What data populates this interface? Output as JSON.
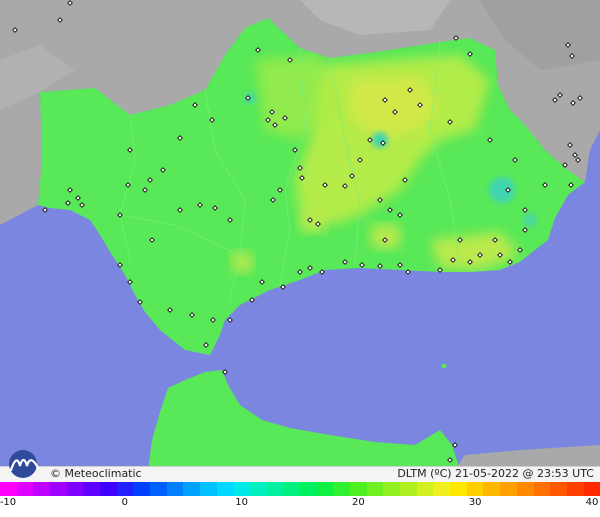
{
  "brand": "© Meteoclimatic",
  "caption": "DLTM (ºC)  21-05-2022 @ 23:53 UTC",
  "legend": {
    "unit": "ºC",
    "min": -10,
    "max": 40,
    "ticks": [
      "-10",
      "0",
      "10",
      "20",
      "30",
      "40"
    ],
    "colors": [
      "#ff00ff",
      "#e000ff",
      "#c000ff",
      "#a000ff",
      "#8000ff",
      "#6000ff",
      "#4000ff",
      "#2020ff",
      "#0040ff",
      "#0060ff",
      "#0080ff",
      "#00a0ff",
      "#00c0ff",
      "#00d8ff",
      "#00e8e8",
      "#00f0c0",
      "#00f0a0",
      "#00f080",
      "#00f060",
      "#10f040",
      "#30f030",
      "#50f020",
      "#70f020",
      "#90f020",
      "#b0f020",
      "#d0f020",
      "#f0f020",
      "#ffe800",
      "#ffd000",
      "#ffb800",
      "#ffa000",
      "#ff8800",
      "#ff7000",
      "#ff5800",
      "#ff4000",
      "#ff2800"
    ]
  },
  "colors": {
    "sea": "#7a86e0",
    "land_outside": "#aaaaaa",
    "region_base": "#58e858",
    "warm_patch": "#c6ea4c",
    "cool_patch": "#3fd4b0",
    "station": "#111111"
  },
  "stations": [
    [
      258,
      50
    ],
    [
      290,
      60
    ],
    [
      248,
      98
    ],
    [
      272,
      112
    ],
    [
      268,
      120
    ],
    [
      275,
      125
    ],
    [
      285,
      118
    ],
    [
      212,
      120
    ],
    [
      195,
      105
    ],
    [
      180,
      138
    ],
    [
      130,
      150
    ],
    [
      163,
      170
    ],
    [
      150,
      180
    ],
    [
      145,
      190
    ],
    [
      128,
      185
    ],
    [
      70,
      190
    ],
    [
      78,
      198
    ],
    [
      82,
      205
    ],
    [
      68,
      203
    ],
    [
      45,
      210
    ],
    [
      180,
      210
    ],
    [
      200,
      205
    ],
    [
      215,
      208
    ],
    [
      230,
      220
    ],
    [
      152,
      240
    ],
    [
      120,
      265
    ],
    [
      130,
      282
    ],
    [
      140,
      302
    ],
    [
      170,
      310
    ],
    [
      192,
      315
    ],
    [
      213,
      320
    ],
    [
      206,
      345
    ],
    [
      230,
      320
    ],
    [
      252,
      300
    ],
    [
      262,
      282
    ],
    [
      283,
      287
    ],
    [
      300,
      272
    ],
    [
      310,
      268
    ],
    [
      322,
      272
    ],
    [
      345,
      262
    ],
    [
      362,
      265
    ],
    [
      380,
      266
    ],
    [
      400,
      265
    ],
    [
      408,
      272
    ],
    [
      385,
      100
    ],
    [
      395,
      112
    ],
    [
      410,
      90
    ],
    [
      420,
      105
    ],
    [
      450,
      122
    ],
    [
      370,
      140
    ],
    [
      383,
      143
    ],
    [
      360,
      160
    ],
    [
      405,
      180
    ],
    [
      380,
      200
    ],
    [
      390,
      210
    ],
    [
      400,
      215
    ],
    [
      352,
      176
    ],
    [
      345,
      186
    ],
    [
      325,
      185
    ],
    [
      295,
      150
    ],
    [
      300,
      168
    ],
    [
      302,
      178
    ],
    [
      280,
      190
    ],
    [
      273,
      200
    ],
    [
      318,
      224
    ],
    [
      310,
      220
    ],
    [
      456,
      38
    ],
    [
      470,
      54
    ],
    [
      490,
      140
    ],
    [
      515,
      160
    ],
    [
      508,
      190
    ],
    [
      525,
      210
    ],
    [
      545,
      185
    ],
    [
      525,
      230
    ],
    [
      570,
      145
    ],
    [
      575,
      155
    ],
    [
      565,
      165
    ],
    [
      578,
      160
    ],
    [
      571,
      185
    ],
    [
      555,
      100
    ],
    [
      560,
      95
    ],
    [
      573,
      103
    ],
    [
      580,
      98
    ],
    [
      568,
      45
    ],
    [
      572,
      56
    ],
    [
      453,
      260
    ],
    [
      470,
      262
    ],
    [
      480,
      255
    ],
    [
      500,
      255
    ],
    [
      510,
      262
    ],
    [
      520,
      250
    ],
    [
      495,
      240
    ],
    [
      385,
      240
    ],
    [
      460,
      240
    ],
    [
      440,
      270
    ],
    [
      15,
      30
    ],
    [
      60,
      20
    ],
    [
      70,
      3
    ],
    [
      120,
      215
    ],
    [
      455,
      445
    ],
    [
      450,
      460
    ],
    [
      225,
      372
    ]
  ]
}
